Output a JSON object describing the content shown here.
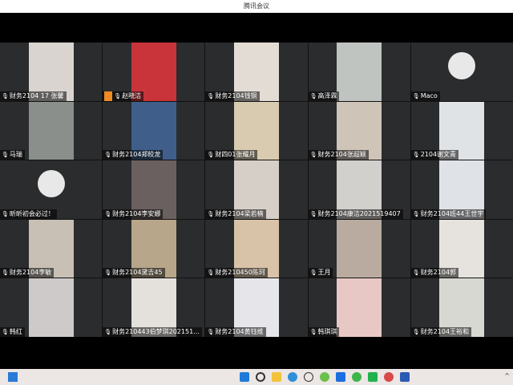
{
  "window": {
    "title": "腾讯会议"
  },
  "participants": [
    {
      "name": "财务2104 17 张馨",
      "video": "#d9d4cf"
    },
    {
      "name": "赵晓洁",
      "video": "#c9343a",
      "host": true
    },
    {
      "name": "财务2104钱铜",
      "video": "#e2dcd4"
    },
    {
      "name": "高泽霖",
      "video": "#bfc4c0"
    },
    {
      "name": "Maco",
      "video": ""
    },
    {
      "name": "马瑞",
      "video": "#8a8f8c"
    },
    {
      "name": "财务2104郑皎龙",
      "video": "#3f5f8a"
    },
    {
      "name": "财四01张耀月",
      "video": "#d8cbb0"
    },
    {
      "name": "财务2104张超颖",
      "video": "#cfc4b8"
    },
    {
      "name": "2104谢文青",
      "video": "#dfe3e5"
    },
    {
      "name": "昕昕初会必过！",
      "video": ""
    },
    {
      "name": "财务2104李安娜",
      "video": "#6b6060"
    },
    {
      "name": "财务2104梁若楠",
      "video": "#d6cfc8"
    },
    {
      "name": "财务2104康洁2021519407",
      "video": "#d2d0cd"
    },
    {
      "name": "财务2104班44王世宇",
      "video": "#dfe2e6"
    },
    {
      "name": "财务2104李敏",
      "video": "#c8c0b5"
    },
    {
      "name": "财务2104黛吉45",
      "video": "#b7a68a"
    },
    {
      "name": "财务210450陈珂",
      "video": "#d9c3a8"
    },
    {
      "name": "王月",
      "video": "#b9aba0"
    },
    {
      "name": "财务2104郭",
      "video": "#e6e2de"
    },
    {
      "name": "韩红",
      "video": "#cfcaca"
    },
    {
      "name": "财务210443伯梦琪202151...",
      "video": "#e4e0dc"
    },
    {
      "name": "财务2104黄钰维",
      "video": "#e6e6ea"
    },
    {
      "name": "韩琪琪",
      "video": "#e8c8c4"
    },
    {
      "name": "财务2104王裕和",
      "video": "#d8d8d2"
    }
  ],
  "taskbar": {
    "tray": "^"
  }
}
